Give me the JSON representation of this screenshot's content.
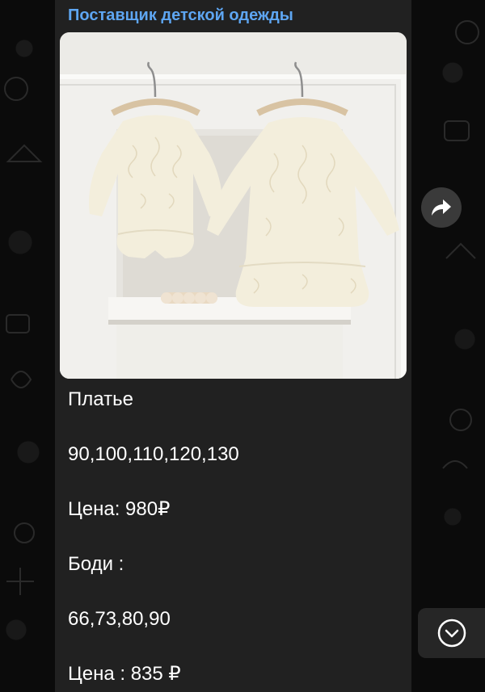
{
  "channel": {
    "sender_name": "Поставщик детской одежды"
  },
  "message": {
    "photo": {
      "subject": "cream-lace-romper-and-dress-on-hangers"
    },
    "caption_lines": [
      "Платье",
      "90,100,110,120,130",
      "Цена: 980₽",
      "Боди :",
      "66,73,80,90",
      "Цена : 835 ₽"
    ]
  },
  "controls": {
    "share_icon": "forward-arrow-icon",
    "scroll_down_icon": "chevron-down-icon"
  },
  "colors": {
    "background": "#0b0b0b",
    "bubble": "#212121",
    "sender_name": "#5ea6f2",
    "text": "#ffffff"
  }
}
